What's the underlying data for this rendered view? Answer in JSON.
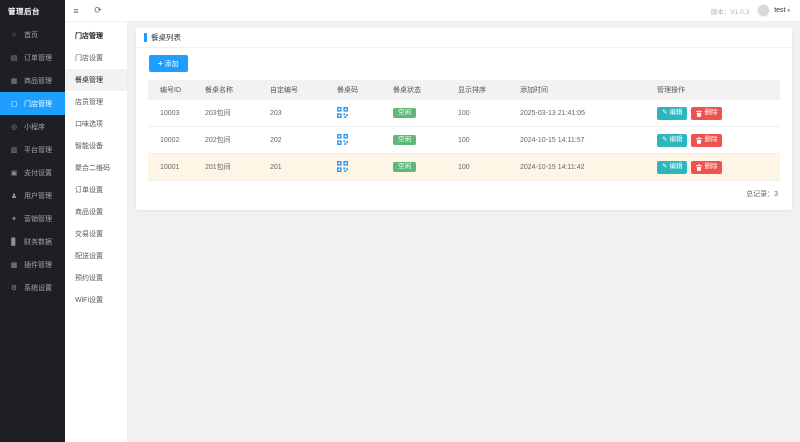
{
  "app": {
    "title": "管理后台",
    "topbar": {
      "collapse_icon": "≡",
      "refresh_icon": "⟳",
      "version": "版本：V1.0.3",
      "username": "test",
      "caret": "▾"
    }
  },
  "sidebar": {
    "items": [
      {
        "icon": "⌂",
        "label": "首页"
      },
      {
        "icon": "▤",
        "label": "订单管理"
      },
      {
        "icon": "▦",
        "label": "商品管理"
      },
      {
        "icon": "▢",
        "label": "门店管理"
      },
      {
        "icon": "◎",
        "label": "小程序"
      },
      {
        "icon": "▥",
        "label": "平台管理"
      },
      {
        "icon": "▣",
        "label": "支付设置"
      },
      {
        "icon": "♟",
        "label": "用户管理"
      },
      {
        "icon": "✦",
        "label": "营销管理"
      },
      {
        "icon": "▊",
        "label": "财务数据"
      },
      {
        "icon": "▩",
        "label": "插件管理"
      },
      {
        "icon": "⚙",
        "label": "系统设置"
      }
    ]
  },
  "submenu": {
    "title": "门店管理",
    "items": [
      "门店设置",
      "餐桌管理",
      "店员管理",
      "口味选项",
      "智能设备",
      "聚合二维码",
      "订单设置",
      "商品设置",
      "交易设置",
      "配送设置",
      "预约设置",
      "WiFi设置"
    ]
  },
  "panel": {
    "title": "餐桌列表",
    "add_button": {
      "icon": "+",
      "label": "添加"
    },
    "total": "总记录：3"
  },
  "table": {
    "headers": [
      "编号ID",
      "餐桌名称",
      "自定编号",
      "餐桌码",
      "餐桌状态",
      "显示排序",
      "添加时间",
      "管理操作"
    ],
    "edit_label": "编辑",
    "delete_label": "删除",
    "rows": [
      {
        "id": "10003",
        "name": "203包间",
        "number": "203",
        "status": "空闲",
        "sort": "100",
        "time": "2025-03-13 21:41:05"
      },
      {
        "id": "10002",
        "name": "202包间",
        "number": "202",
        "status": "空闲",
        "sort": "100",
        "time": "2024-10-15 14:11:57"
      },
      {
        "id": "10001",
        "name": "201包间",
        "number": "201",
        "status": "空闲",
        "sort": "100",
        "time": "2024-10-15 14:11:42"
      }
    ]
  },
  "colors": {
    "accent": "#1e9fff",
    "success": "#5fb878",
    "edit": "#2bb7bd",
    "danger": "#ef5350",
    "row_highlight": "#fdf5e6",
    "sidebar_bg": "#1e1f22"
  }
}
